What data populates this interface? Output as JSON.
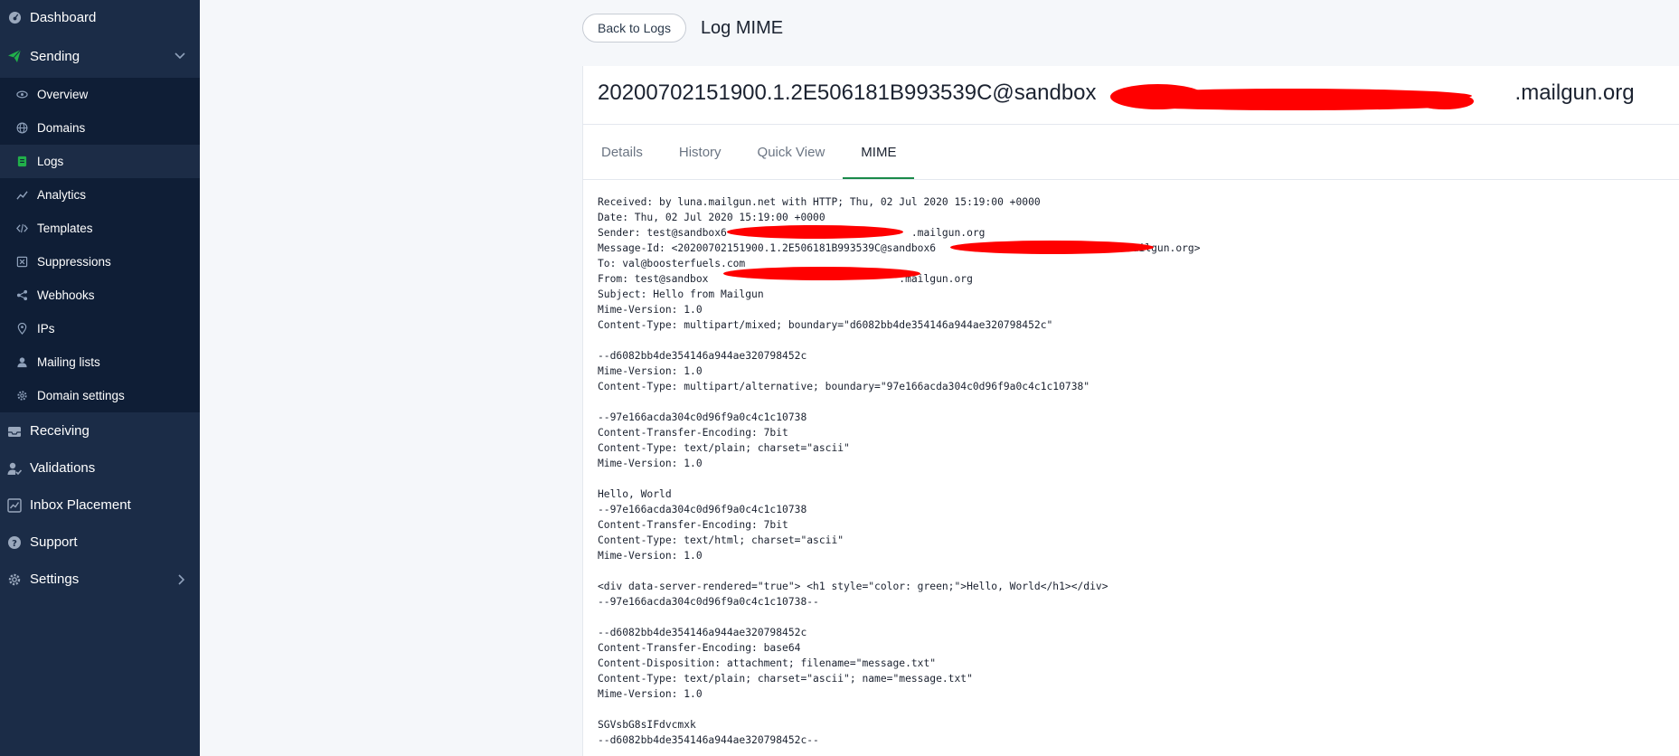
{
  "sidebar": {
    "dashboard": "Dashboard",
    "sending": "Sending",
    "sub_items": [
      {
        "label": "Overview",
        "icon": "eye-icon"
      },
      {
        "label": "Domains",
        "icon": "globe-icon"
      },
      {
        "label": "Logs",
        "icon": "logs-icon"
      },
      {
        "label": "Analytics",
        "icon": "analytics-icon"
      },
      {
        "label": "Templates",
        "icon": "code-icon"
      },
      {
        "label": "Suppressions",
        "icon": "suppressions-icon"
      },
      {
        "label": "Webhooks",
        "icon": "webhooks-icon"
      },
      {
        "label": "IPs",
        "icon": "location-pin-icon"
      },
      {
        "label": "Mailing lists",
        "icon": "user-icon"
      },
      {
        "label": "Domain settings",
        "icon": "gear-icon"
      }
    ],
    "receiving": "Receiving",
    "validations": "Validations",
    "inbox_placement": "Inbox Placement",
    "support": "Support",
    "settings": "Settings",
    "accent_color": "#21b04a"
  },
  "header": {
    "back_button": "Back to Logs",
    "title": "Log MIME"
  },
  "message": {
    "id_prefix": "20200702151900.1.2E506181B993539C@sandbox",
    "id_suffix": ".mailgun.org"
  },
  "tabs": [
    "Details",
    "History",
    "Quick View",
    "MIME"
  ],
  "active_tab": "MIME",
  "mime_lines": [
    "Received: by luna.mailgun.net with HTTP; Thu, 02 Jul 2020 15:19:00 +0000",
    "Date: Thu, 02 Jul 2020 15:19:00 +0000",
    "Sender: test@sandbox6                              .mailgun.org",
    "Message-Id: <20200702151900.1.2E506181B993539C@sandbox6                              .mailgun.org>",
    "To: val@boosterfuels.com",
    "From: test@sandbox                               .mailgun.org",
    "Subject: Hello from Mailgun",
    "Mime-Version: 1.0",
    "Content-Type: multipart/mixed; boundary=\"d6082bb4de354146a944ae320798452c\"",
    "",
    "--d6082bb4de354146a944ae320798452c",
    "Mime-Version: 1.0",
    "Content-Type: multipart/alternative; boundary=\"97e166acda304c0d96f9a0c4c1c10738\"",
    "",
    "--97e166acda304c0d96f9a0c4c1c10738",
    "Content-Transfer-Encoding: 7bit",
    "Content-Type: text/plain; charset=\"ascii\"",
    "Mime-Version: 1.0",
    "",
    "Hello, World",
    "--97e166acda304c0d96f9a0c4c1c10738",
    "Content-Transfer-Encoding: 7bit",
    "Content-Type: text/html; charset=\"ascii\"",
    "Mime-Version: 1.0",
    "",
    "<div data-server-rendered=\"true\"> <h1 style=\"color: green;\">Hello, World</h1></div>",
    "--97e166acda304c0d96f9a0c4c1c10738--",
    "",
    "--d6082bb4de354146a944ae320798452c",
    "Content-Transfer-Encoding: base64",
    "Content-Disposition: attachment; filename=\"message.txt\"",
    "Content-Type: text/plain; charset=\"ascii\"; name=\"message.txt\"",
    "Mime-Version: 1.0",
    "",
    "SGVsbG8sIFdvcmxk",
    "--d6082bb4de354146a944ae320798452c--"
  ]
}
